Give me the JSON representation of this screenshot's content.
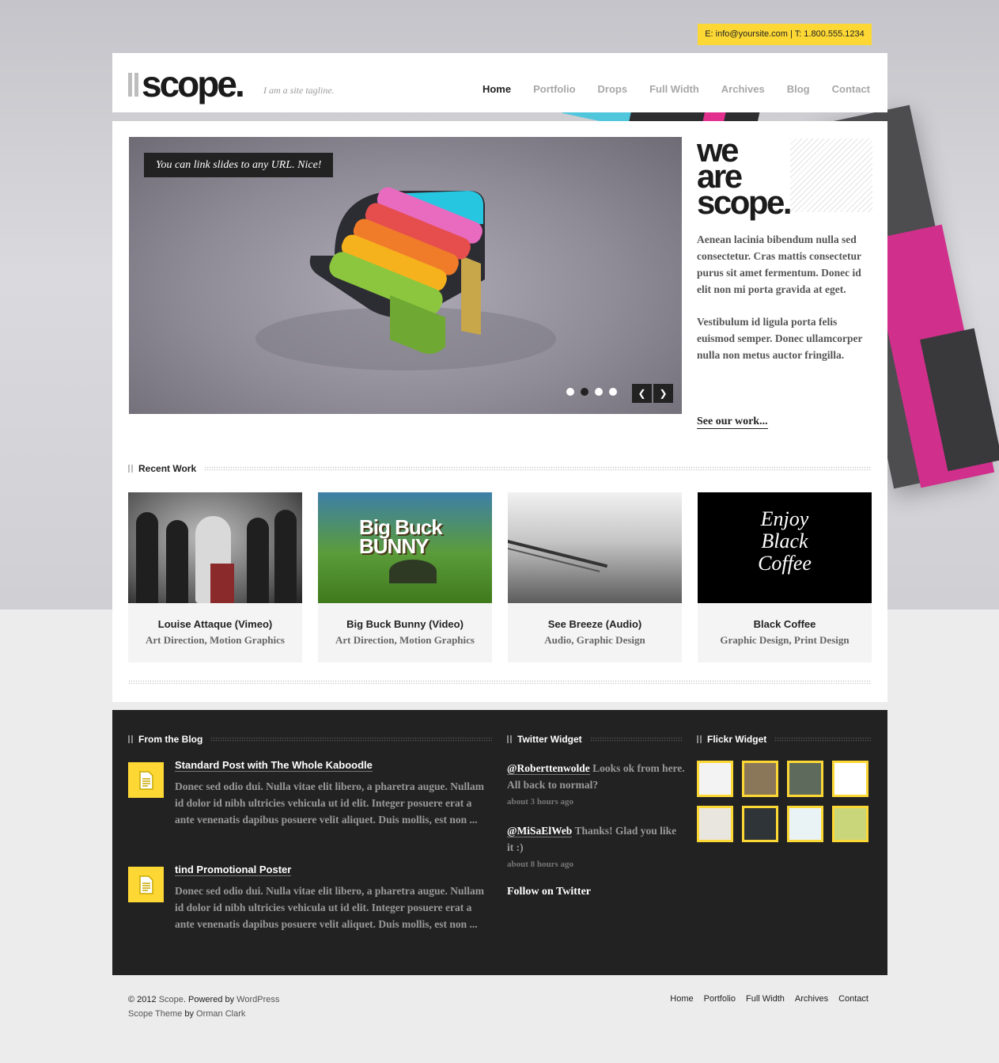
{
  "contact": {
    "text": "E: info@yoursite.com | T: 1.800.555.1234"
  },
  "header": {
    "logo": "scope.",
    "tagline": "I am a site tagline.",
    "nav": [
      "Home",
      "Portfolio",
      "Drops",
      "Full Width",
      "Archives",
      "Blog",
      "Contact"
    ],
    "active": "Home"
  },
  "slider": {
    "caption": "You can link slides to any URL. Nice!",
    "slide_count": 4,
    "current_slide": 2,
    "prev_icon": "chevron-left-icon",
    "next_icon": "chevron-right-icon"
  },
  "intro": {
    "line1": "we",
    "line2": "are",
    "line3": "scope.",
    "para1": "Aenean lacinia bibendum nulla sed consectetur. Cras mattis consectetur purus sit amet fermentum. Donec id elit non mi porta gravida at eget.",
    "para2": "Vestibulum id ligula porta felis euismod semper. Donec ullamcorper nulla non metus auctor fringilla.",
    "link": "See our work..."
  },
  "recent_work": {
    "heading": "Recent Work",
    "items": [
      {
        "title": "Louise Attaque (Vimeo)",
        "tags": "Art Direction, Motion Graphics"
      },
      {
        "title": "Big Buck Bunny (Video)",
        "tags": "Art Direction, Motion Graphics"
      },
      {
        "title": "See Breeze (Audio)",
        "tags": "Audio, Graphic Design"
      },
      {
        "title": "Black Coffee",
        "tags": "Graphic Design, Print Design"
      }
    ],
    "thumb_texts": {
      "bunny_line1": "Big Buck",
      "bunny_line2": "BUNNY",
      "coffee_line1": "Enjoy",
      "coffee_line2": "Black",
      "coffee_line3": "Coffee"
    }
  },
  "blog": {
    "heading": "From the Blog",
    "posts": [
      {
        "title": "Standard Post with The Whole Kaboodle",
        "excerpt": "Donec sed odio dui. Nulla vitae elit libero, a pharetra augue. Nullam id dolor id nibh ultricies vehicula ut id elit. Integer posuere erat a ante venenatis dapibus posuere velit aliquet. Duis mollis, est non ..."
      },
      {
        "title": "tind Promotional Poster",
        "excerpt": "Donec sed odio dui. Nulla vitae elit libero, a pharetra augue. Nullam id dolor id nibh ultricies vehicula ut id elit. Integer posuere erat a ante venenatis dapibus posuere velit aliquet. Duis mollis, est non ..."
      }
    ]
  },
  "twitter": {
    "heading": "Twitter Widget",
    "tweets": [
      {
        "user": "@Roberttenwolde",
        "text": " Looks ok from here. All back to normal?",
        "ago": "about 3 hours ago"
      },
      {
        "user": "@MiSaElWeb",
        "text": " Thanks! Glad you like it :)",
        "ago": "about 8 hours ago"
      }
    ],
    "follow": "Follow on Twitter"
  },
  "flickr": {
    "heading": "Flickr Widget",
    "colors": [
      "#f3f3f3",
      "#8a7658",
      "#5e6a5c",
      "#ffffff",
      "#e8e6df",
      "#2f3438",
      "#e9f3f6",
      "#c9d77a"
    ]
  },
  "footer": {
    "line1_prefix": "© 2012 ",
    "site": "Scope",
    "line1_mid": ". Powered by ",
    "wordpress": "WordPress",
    "line2_prefix": "Scope Theme",
    "line2_mid": " by ",
    "author": "Orman Clark",
    "nav": [
      "Home",
      "Portfolio",
      "Full Width",
      "Archives",
      "Contact"
    ]
  },
  "colors": {
    "accent": "#fdd835",
    "dark": "#222222"
  }
}
